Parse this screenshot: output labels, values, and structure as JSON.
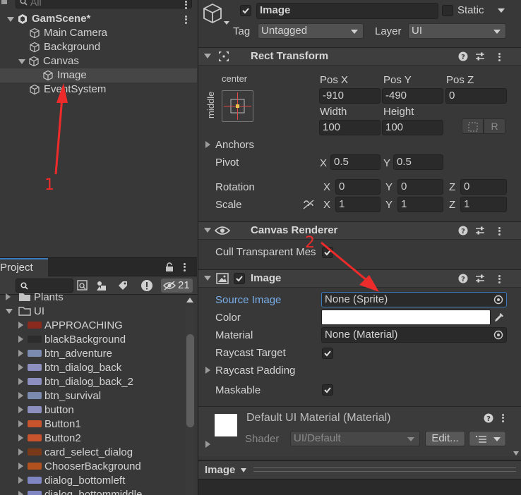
{
  "hierarchy": {
    "search_placeholder": "All",
    "scene_name": "GamScene*",
    "items": [
      {
        "label": "Main Camera"
      },
      {
        "label": "Background"
      },
      {
        "label": "Canvas"
      },
      {
        "label": "Image"
      },
      {
        "label": "EventSystem"
      }
    ],
    "annotation_1": "1"
  },
  "project": {
    "tab_label": "Project",
    "hidden_count": "21",
    "folders": [
      {
        "label": "Plants"
      },
      {
        "label": "UI"
      }
    ],
    "assets": [
      {
        "label": "APPROACHING",
        "color": "#8a2a1e"
      },
      {
        "label": "blackBackground",
        "color": "#2c2c2c"
      },
      {
        "label": "btn_adventure",
        "color": "#7b8bb0"
      },
      {
        "label": "btn_dialog_back",
        "color": "#8d8fbf"
      },
      {
        "label": "btn_dialog_back_2",
        "color": "#8d8fbf"
      },
      {
        "label": "btn_survival",
        "color": "#7b8bb0"
      },
      {
        "label": "button",
        "color": "#8d8fbf"
      },
      {
        "label": "Button1",
        "color": "#c7542c"
      },
      {
        "label": "Button2",
        "color": "#c7542c"
      },
      {
        "label": "card_select_dialog",
        "color": "#7a3a1a"
      },
      {
        "label": "ChooserBackground",
        "color": "#b1521e"
      },
      {
        "label": "dialog_bottomleft",
        "color": "#7f86c2"
      },
      {
        "label": "dialog_bottommiddle",
        "color": "#7f86c2"
      }
    ]
  },
  "inspector": {
    "object_name": "Image",
    "static_label": "Static",
    "tag_label": "Tag",
    "tag_value": "Untagged",
    "layer_label": "Layer",
    "layer_value": "UI",
    "rect_transform": {
      "title": "Rect Transform",
      "anchor_h": "center",
      "anchor_v": "middle",
      "pos_x_label": "Pos X",
      "pos_y_label": "Pos Y",
      "pos_z_label": "Pos Z",
      "pos_x": "-910",
      "pos_y": "-490",
      "pos_z": "0",
      "width_label": "Width",
      "height_label": "Height",
      "width": "100",
      "height": "100",
      "r_button": "R",
      "anchors_label": "Anchors",
      "pivot_label": "Pivot",
      "pivot_x": "0.5",
      "pivot_y": "0.5",
      "rotation_label": "Rotation",
      "rot_x": "0",
      "rot_y": "0",
      "rot_z": "0",
      "scale_label": "Scale",
      "scale_x": "1",
      "scale_y": "1",
      "scale_z": "1",
      "x": "X",
      "y": "Y",
      "z": "Z"
    },
    "canvas_renderer": {
      "title": "Canvas Renderer",
      "cull_label": "Cull Transparent Mes"
    },
    "image": {
      "title": "Image",
      "source_image_label": "Source Image",
      "source_image_value": "None (Sprite)",
      "color_label": "Color",
      "material_label": "Material",
      "material_value": "None (Material)",
      "raycast_target_label": "Raycast Target",
      "raycast_padding_label": "Raycast Padding",
      "maskable_label": "Maskable"
    },
    "material": {
      "title": "Default UI Material (Material)",
      "shader_label": "Shader",
      "shader_value": "UI/Default",
      "edit_label": "Edit..."
    },
    "preview": {
      "title": "Image"
    },
    "annotation_2": "2"
  },
  "colors": {
    "accent": "#3a79bb",
    "annotation": "#ee2b2b",
    "link": "#7aaee8"
  }
}
